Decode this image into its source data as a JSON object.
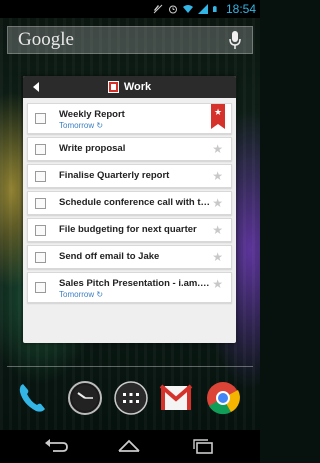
{
  "status_bar": {
    "time": "18:54",
    "icons": [
      "mute-icon",
      "alarm-icon",
      "wifi-icon",
      "signal-icon",
      "battery-icon"
    ]
  },
  "search_bar": {
    "logo_text": "Google",
    "icon": "mic-icon"
  },
  "widget": {
    "title": "Work",
    "header_icons": [
      "back-arrow-icon",
      "list-icon"
    ],
    "tasks": [
      {
        "text": "Weekly Report",
        "due": "Tomorrow",
        "starred": true
      },
      {
        "text": "Write proposal",
        "due": "",
        "starred": false
      },
      {
        "text": "Finalise Quarterly report",
        "due": "",
        "starred": false
      },
      {
        "text": "Schedule conference call with the...",
        "due": "",
        "starred": false
      },
      {
        "text": "File budgeting for next quarter",
        "due": "",
        "starred": false
      },
      {
        "text": "Send off email to Jake",
        "due": "",
        "starred": false
      },
      {
        "text": "Sales Pitch Presentation - i.am.e...",
        "due": "Tomorrow",
        "starred": false
      }
    ],
    "colors": {
      "accent": "#d6322c",
      "due_text": "#3b7fc4"
    }
  },
  "dock": {
    "apps": [
      "phone-icon",
      "clock-icon",
      "all-apps-icon",
      "gmail-icon",
      "chrome-icon"
    ]
  },
  "nav_bar": {
    "buttons": [
      "back-icon",
      "home-icon",
      "recent-apps-icon"
    ]
  },
  "colors": {
    "status_blue": "#33b5e5"
  }
}
